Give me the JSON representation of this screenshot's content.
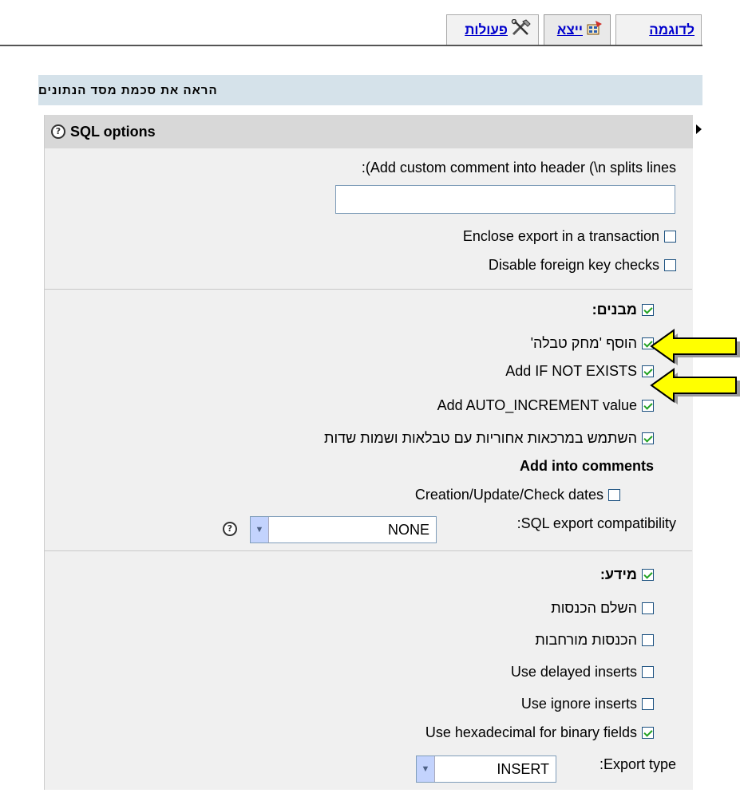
{
  "tabs": [
    {
      "label": "לדוגמה",
      "icon": "example"
    },
    {
      "label": "ייצא",
      "icon": "export-icon"
    },
    {
      "label": "פעולות",
      "icon": "tools-icon"
    }
  ],
  "title": "הראה את סכמת מסד הנתונים",
  "sql_options": {
    "legend": "SQL options",
    "custom_comment_label": ":(Add custom comment into header (\\n splits lines",
    "custom_comment_value": "",
    "enclose_transaction": {
      "label": "Enclose export in a transaction",
      "checked": false
    },
    "disable_fk": {
      "label": "Disable foreign key checks",
      "checked": false
    }
  },
  "structure": {
    "label": "מבנים:",
    "checked": true,
    "drop_table": {
      "label": "הוסף 'מחק טבלה'",
      "checked": true
    },
    "if_not_exists": {
      "label": "Add IF NOT EXISTS",
      "checked": true
    },
    "auto_increment": {
      "label": "Add AUTO_INCREMENT value",
      "checked": true
    },
    "backquotes": {
      "label": "השתמש במרכאות אחוריות עם טבלאות ושמות שדות",
      "checked": true
    },
    "add_into_comments": "Add into comments",
    "dates": {
      "label": "Creation/Update/Check dates",
      "checked": false
    },
    "compat_label": ":SQL export compatibility",
    "compat_value": "NONE"
  },
  "data": {
    "label": "מידע:",
    "checked": true,
    "complete_inserts": {
      "label": "השלם הכנסות",
      "checked": false
    },
    "extended_inserts": {
      "label": "הכנסות מורחבות",
      "checked": false
    },
    "delayed_inserts": {
      "label": "Use delayed inserts",
      "checked": false
    },
    "ignore_inserts": {
      "label": "Use ignore inserts",
      "checked": false
    },
    "hex_binary": {
      "label": "Use hexadecimal for binary fields",
      "checked": true
    },
    "export_type_label": ":Export type",
    "export_type_value": "INSERT"
  },
  "colors": {
    "accent_arrow": "#ffff00",
    "header_bg": "#d5e2ea",
    "panel_bg": "#f0f0f0",
    "check": "#21a121"
  }
}
